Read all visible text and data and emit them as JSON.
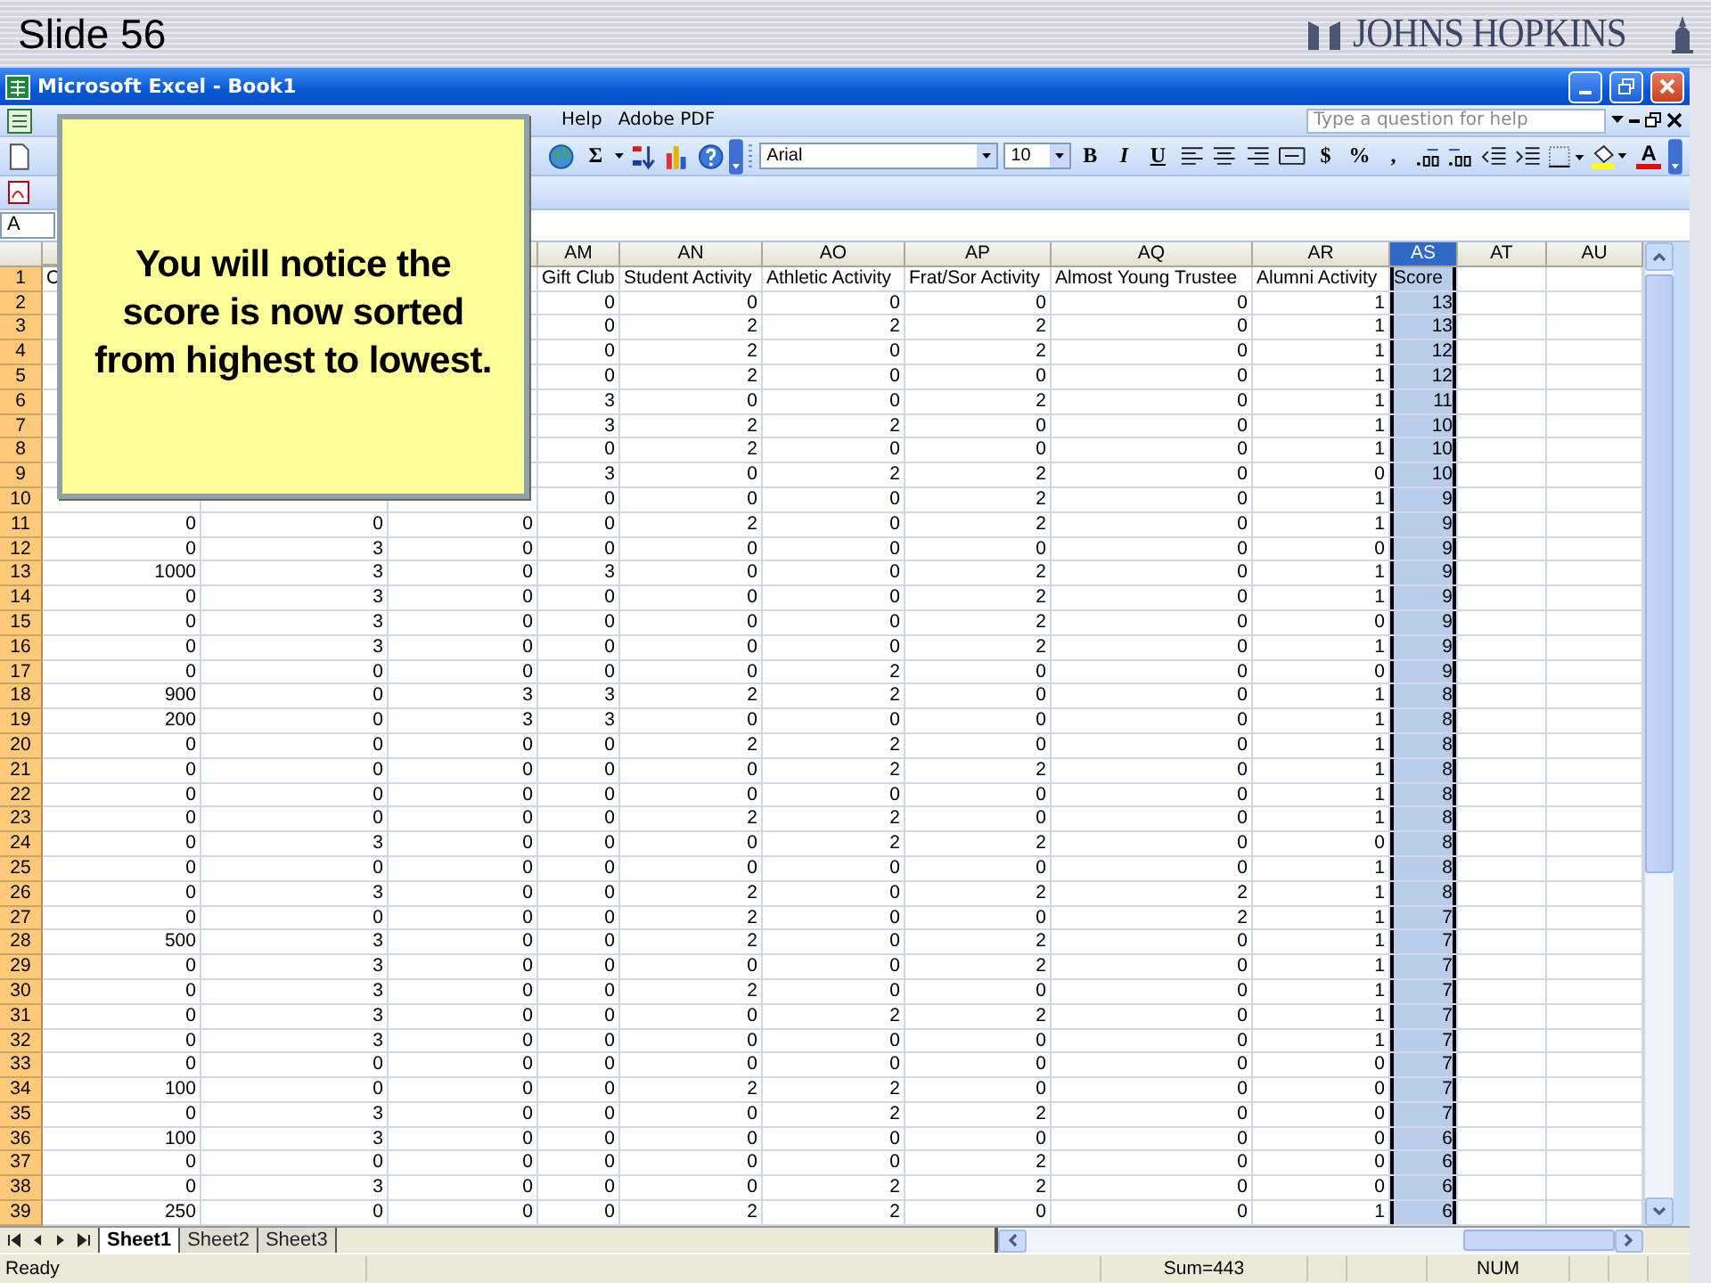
{
  "slide": {
    "title": "Slide 56",
    "logo_text": "JOHNS HOPKINS"
  },
  "window": {
    "title": "Microsoft Excel - Book1"
  },
  "menu": {
    "items": [
      "Help",
      "Adobe PDF"
    ],
    "help_field": {
      "placeholder": "Type a question for help"
    }
  },
  "standard_toolbar": {
    "sum_label": "Σ"
  },
  "formatting_toolbar": {
    "font": "Arial",
    "size": "10",
    "style_buttons": [
      "B",
      "I",
      "U"
    ],
    "number_buttons": [
      "$",
      "%",
      ","
    ],
    "font_color_label": "A"
  },
  "formula_bar": {
    "name_box": "A"
  },
  "column_headers": [
    {
      "label": "AM",
      "selected": false
    },
    {
      "label": "AN",
      "selected": false
    },
    {
      "label": "AO",
      "selected": false
    },
    {
      "label": "AP",
      "selected": false
    },
    {
      "label": "AQ",
      "selected": false
    },
    {
      "label": "AR",
      "selected": false
    },
    {
      "label": "AS",
      "selected": true
    },
    {
      "label": "AT",
      "selected": false
    },
    {
      "label": "AU",
      "selected": false
    }
  ],
  "rows": [
    {
      "number": "1",
      "kind": "header",
      "left_cells": [
        "C"
      ],
      "cells": [
        "Gift Club",
        "Student Activity",
        "Athletic Activity",
        "Frat/Sor Activity",
        "Almost Young Trustee",
        "Alumni Activity",
        "Score"
      ]
    },
    {
      "number": "2",
      "kind": "data",
      "cells": [
        "0",
        "0",
        "0",
        "0",
        "0",
        "1",
        "13"
      ]
    },
    {
      "number": "3",
      "kind": "data",
      "cells": [
        "0",
        "2",
        "2",
        "2",
        "0",
        "1",
        "13"
      ]
    },
    {
      "number": "4",
      "kind": "data",
      "cells": [
        "0",
        "2",
        "0",
        "2",
        "0",
        "1",
        "12"
      ]
    },
    {
      "number": "5",
      "kind": "data",
      "cells": [
        "0",
        "2",
        "0",
        "0",
        "0",
        "1",
        "12"
      ]
    },
    {
      "number": "6",
      "kind": "data",
      "cells": [
        "3",
        "0",
        "0",
        "2",
        "0",
        "1",
        "11"
      ]
    },
    {
      "number": "7",
      "kind": "data",
      "cells": [
        "3",
        "2",
        "2",
        "0",
        "0",
        "1",
        "10"
      ]
    },
    {
      "number": "8",
      "kind": "data",
      "cells": [
        "0",
        "2",
        "0",
        "0",
        "0",
        "1",
        "10"
      ]
    },
    {
      "number": "9",
      "kind": "data",
      "cells": [
        "3",
        "0",
        "2",
        "2",
        "0",
        "0",
        "10"
      ]
    },
    {
      "number": "10",
      "kind": "data",
      "cells": [
        "0",
        "0",
        "0",
        "2",
        "0",
        "1",
        "9"
      ]
    },
    {
      "number": "11",
      "kind": "data",
      "cells": [
        "0",
        "0",
        "0",
        "0",
        "2",
        "0",
        "2",
        "0",
        "1",
        "9"
      ]
    },
    {
      "number": "12",
      "kind": "data",
      "cells": [
        "0",
        "3",
        "0",
        "0",
        "0",
        "0",
        "0",
        "0",
        "0",
        "9"
      ]
    },
    {
      "number": "13",
      "kind": "data",
      "cells": [
        "1000",
        "3",
        "0",
        "3",
        "0",
        "0",
        "2",
        "0",
        "1",
        "9"
      ]
    },
    {
      "number": "14",
      "kind": "data",
      "cells": [
        "0",
        "3",
        "0",
        "0",
        "0",
        "0",
        "2",
        "0",
        "1",
        "9"
      ]
    },
    {
      "number": "15",
      "kind": "data",
      "cells": [
        "0",
        "3",
        "0",
        "0",
        "0",
        "0",
        "2",
        "0",
        "0",
        "9"
      ]
    },
    {
      "number": "16",
      "kind": "data",
      "cells": [
        "0",
        "3",
        "0",
        "0",
        "0",
        "0",
        "2",
        "0",
        "1",
        "9"
      ]
    },
    {
      "number": "17",
      "kind": "data",
      "cells": [
        "0",
        "0",
        "0",
        "0",
        "0",
        "2",
        "0",
        "0",
        "0",
        "9"
      ]
    },
    {
      "number": "18",
      "kind": "data",
      "cells": [
        "900",
        "0",
        "3",
        "3",
        "2",
        "2",
        "0",
        "0",
        "1",
        "8"
      ]
    },
    {
      "number": "19",
      "kind": "data",
      "cells": [
        "200",
        "0",
        "3",
        "3",
        "0",
        "0",
        "0",
        "0",
        "1",
        "8"
      ]
    },
    {
      "number": "20",
      "kind": "data",
      "cells": [
        "0",
        "0",
        "0",
        "0",
        "2",
        "2",
        "0",
        "0",
        "1",
        "8"
      ]
    },
    {
      "number": "21",
      "kind": "data",
      "cells": [
        "0",
        "0",
        "0",
        "0",
        "0",
        "2",
        "2",
        "0",
        "1",
        "8"
      ]
    },
    {
      "number": "22",
      "kind": "data",
      "cells": [
        "0",
        "0",
        "0",
        "0",
        "0",
        "0",
        "0",
        "0",
        "1",
        "8"
      ]
    },
    {
      "number": "23",
      "kind": "data",
      "cells": [
        "0",
        "0",
        "0",
        "0",
        "2",
        "2",
        "0",
        "0",
        "1",
        "8"
      ]
    },
    {
      "number": "24",
      "kind": "data",
      "cells": [
        "0",
        "3",
        "0",
        "0",
        "0",
        "2",
        "2",
        "0",
        "0",
        "8"
      ]
    },
    {
      "number": "25",
      "kind": "data",
      "cells": [
        "0",
        "0",
        "0",
        "0",
        "0",
        "0",
        "0",
        "0",
        "1",
        "8"
      ]
    },
    {
      "number": "26",
      "kind": "data",
      "cells": [
        "0",
        "3",
        "0",
        "0",
        "2",
        "0",
        "2",
        "2",
        "1",
        "8"
      ]
    },
    {
      "number": "27",
      "kind": "data",
      "cells": [
        "0",
        "0",
        "0",
        "0",
        "2",
        "0",
        "0",
        "2",
        "1",
        "7"
      ]
    },
    {
      "number": "28",
      "kind": "data",
      "cells": [
        "500",
        "3",
        "0",
        "0",
        "2",
        "0",
        "2",
        "0",
        "1",
        "7"
      ]
    },
    {
      "number": "29",
      "kind": "data",
      "cells": [
        "0",
        "3",
        "0",
        "0",
        "0",
        "0",
        "2",
        "0",
        "1",
        "7"
      ]
    },
    {
      "number": "30",
      "kind": "data",
      "cells": [
        "0",
        "3",
        "0",
        "0",
        "2",
        "0",
        "0",
        "0",
        "1",
        "7"
      ]
    },
    {
      "number": "31",
      "kind": "data",
      "cells": [
        "0",
        "3",
        "0",
        "0",
        "0",
        "2",
        "2",
        "0",
        "1",
        "7"
      ]
    },
    {
      "number": "32",
      "kind": "data",
      "cells": [
        "0",
        "3",
        "0",
        "0",
        "0",
        "0",
        "0",
        "0",
        "1",
        "7"
      ]
    },
    {
      "number": "33",
      "kind": "data",
      "cells": [
        "0",
        "0",
        "0",
        "0",
        "0",
        "0",
        "0",
        "0",
        "0",
        "7"
      ]
    },
    {
      "number": "34",
      "kind": "data",
      "cells": [
        "100",
        "0",
        "0",
        "0",
        "2",
        "2",
        "0",
        "0",
        "0",
        "7"
      ]
    },
    {
      "number": "35",
      "kind": "data",
      "cells": [
        "0",
        "3",
        "0",
        "0",
        "0",
        "2",
        "2",
        "0",
        "0",
        "7"
      ]
    },
    {
      "number": "36",
      "kind": "data",
      "cells": [
        "100",
        "3",
        "0",
        "0",
        "0",
        "0",
        "0",
        "0",
        "0",
        "6"
      ]
    },
    {
      "number": "37",
      "kind": "data",
      "cells": [
        "0",
        "0",
        "0",
        "0",
        "0",
        "0",
        "2",
        "0",
        "0",
        "6"
      ]
    },
    {
      "number": "38",
      "kind": "data",
      "cells": [
        "0",
        "3",
        "0",
        "0",
        "0",
        "2",
        "2",
        "0",
        "0",
        "6"
      ]
    },
    {
      "number": "39",
      "kind": "data",
      "cells": [
        "250",
        "0",
        "0",
        "0",
        "2",
        "2",
        "0",
        "0",
        "1",
        "6"
      ]
    }
  ],
  "sheet_tabs": [
    {
      "label": "Sheet1",
      "selected": true
    },
    {
      "label": "Sheet2",
      "selected": false
    },
    {
      "label": "Sheet3",
      "selected": false
    }
  ],
  "status_bar": {
    "mode": "Ready",
    "sum": "Sum=443",
    "num_lock": "NUM"
  },
  "callout": {
    "text": "You will notice the score is now sorted from highest to lowest."
  }
}
